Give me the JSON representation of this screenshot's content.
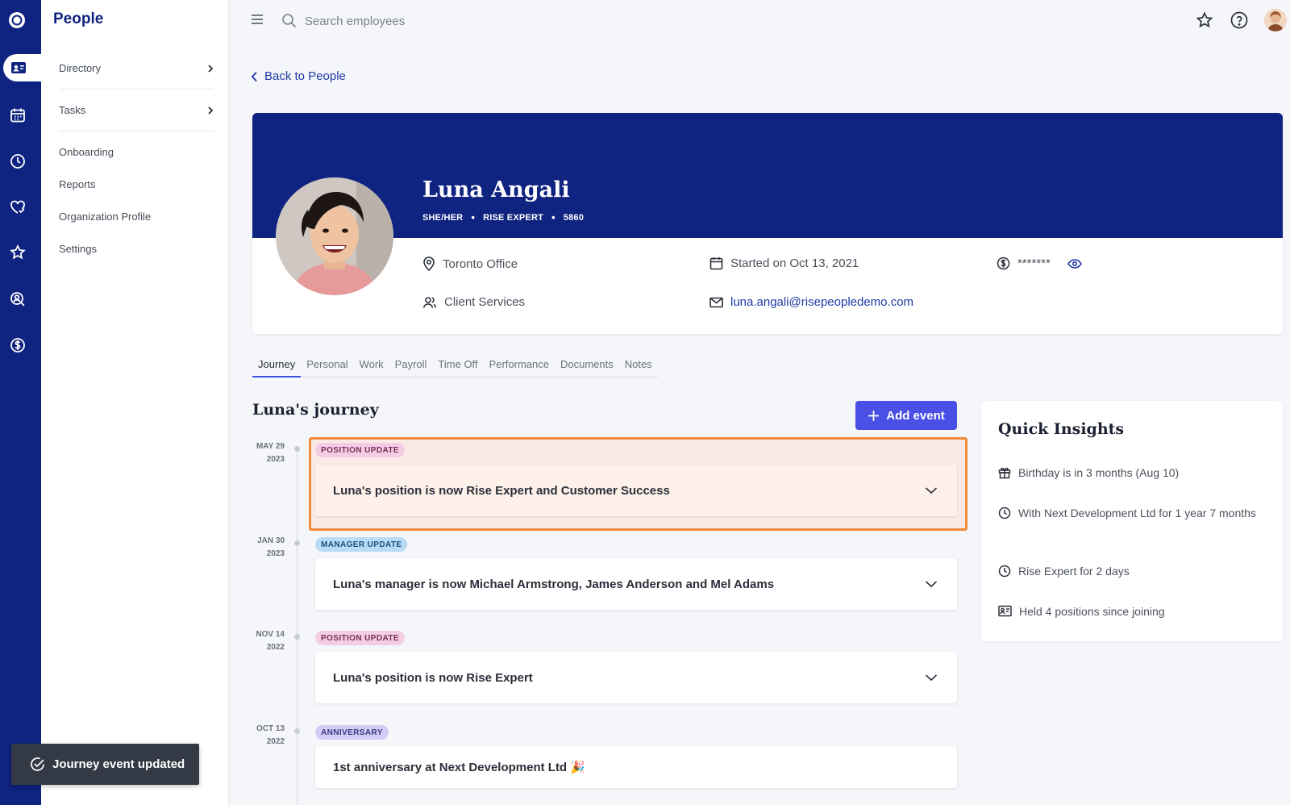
{
  "app": {
    "section_title": "People"
  },
  "colors": {
    "brand_navy": "#0f2380",
    "accent": "#4a4fe6",
    "highlight": "#f08a3c"
  },
  "rail": {
    "icons": [
      "logo-icon",
      "directory-card-icon",
      "calendar-icon",
      "clock-icon",
      "heart-hands-icon",
      "star-icon",
      "person-search-icon",
      "dollar-icon"
    ]
  },
  "sidebar": {
    "items": [
      {
        "label": "Directory"
      },
      {
        "label": "Tasks"
      },
      {
        "label": "Onboarding"
      },
      {
        "label": "Reports"
      },
      {
        "label": "Organization Profile"
      },
      {
        "label": "Settings"
      }
    ]
  },
  "topbar": {
    "search_placeholder": "Search employees"
  },
  "back_label": "Back to People",
  "profile": {
    "name": "Luna Angali",
    "pronouns": "SHE/HER",
    "title": "RISE EXPERT",
    "employee_id": "5860",
    "separator": "•",
    "location": "Toronto Office",
    "department": "Client Services",
    "start": "Started on Oct 13, 2021",
    "email": "luna.angali@risepeopledemo.com",
    "salary_masked": "*******"
  },
  "tabs": [
    {
      "label": "Journey"
    },
    {
      "label": "Personal"
    },
    {
      "label": "Work"
    },
    {
      "label": "Payroll"
    },
    {
      "label": "Time Off"
    },
    {
      "label": "Performance"
    },
    {
      "label": "Documents"
    },
    {
      "label": "Notes"
    }
  ],
  "journey": {
    "title": "Luna's journey",
    "add_label": "Add event",
    "events": [
      {
        "month_day": "MAY 29",
        "year": "2023",
        "tag": "POSITION UPDATE",
        "text": "Luna's position is now Rise Expert and Customer Success"
      },
      {
        "month_day": "JAN 30",
        "year": "2023",
        "tag": "MANAGER UPDATE",
        "text": "Luna's manager is now Michael Armstrong, James Anderson and Mel Adams"
      },
      {
        "month_day": "NOV 14",
        "year": "2022",
        "tag": "POSITION UPDATE",
        "text": "Luna's position is now Rise Expert"
      },
      {
        "month_day": "OCT 13",
        "year": "2022",
        "tag": "ANNIVERSARY",
        "text": "1st anniversary at Next Development Ltd 🎉"
      }
    ]
  },
  "insights": {
    "title": "Quick Insights",
    "items": [
      {
        "text": "Birthday is in 3 months (Aug 10)"
      },
      {
        "text": "With Next Development Ltd for 1 year 7 months"
      },
      {
        "text": "Rise Expert for 2 days"
      },
      {
        "text": "Held 4 positions since joining"
      }
    ]
  },
  "toast": {
    "message": "Journey event updated"
  }
}
